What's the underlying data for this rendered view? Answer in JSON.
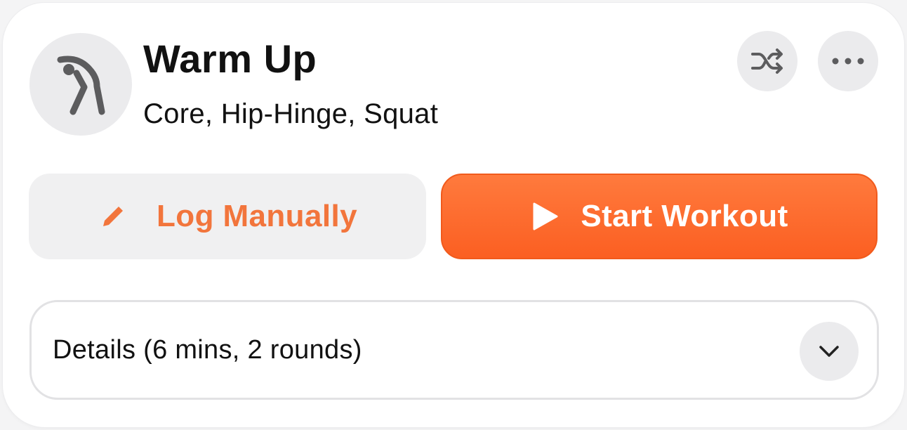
{
  "workout": {
    "title": "Warm Up",
    "subtitle": "Core, Hip-Hinge, Squat",
    "icon": "stretching-figure-icon"
  },
  "header_actions": [
    {
      "icon": "shuffle-icon"
    },
    {
      "icon": "more-horizontal-icon"
    }
  ],
  "buttons": {
    "log_manually": {
      "label": "Log Manually",
      "icon": "pencil-icon"
    },
    "start_workout": {
      "label": "Start Workout",
      "icon": "play-icon"
    }
  },
  "details": {
    "label": "Details (6 mins, 2 rounds)",
    "icon": "chevron-down-icon"
  },
  "colors": {
    "accent": "#fb5f22",
    "accent_text": "#f2753c",
    "icon_gray": "#5c5c5e",
    "chip_bg": "#ebebed"
  }
}
